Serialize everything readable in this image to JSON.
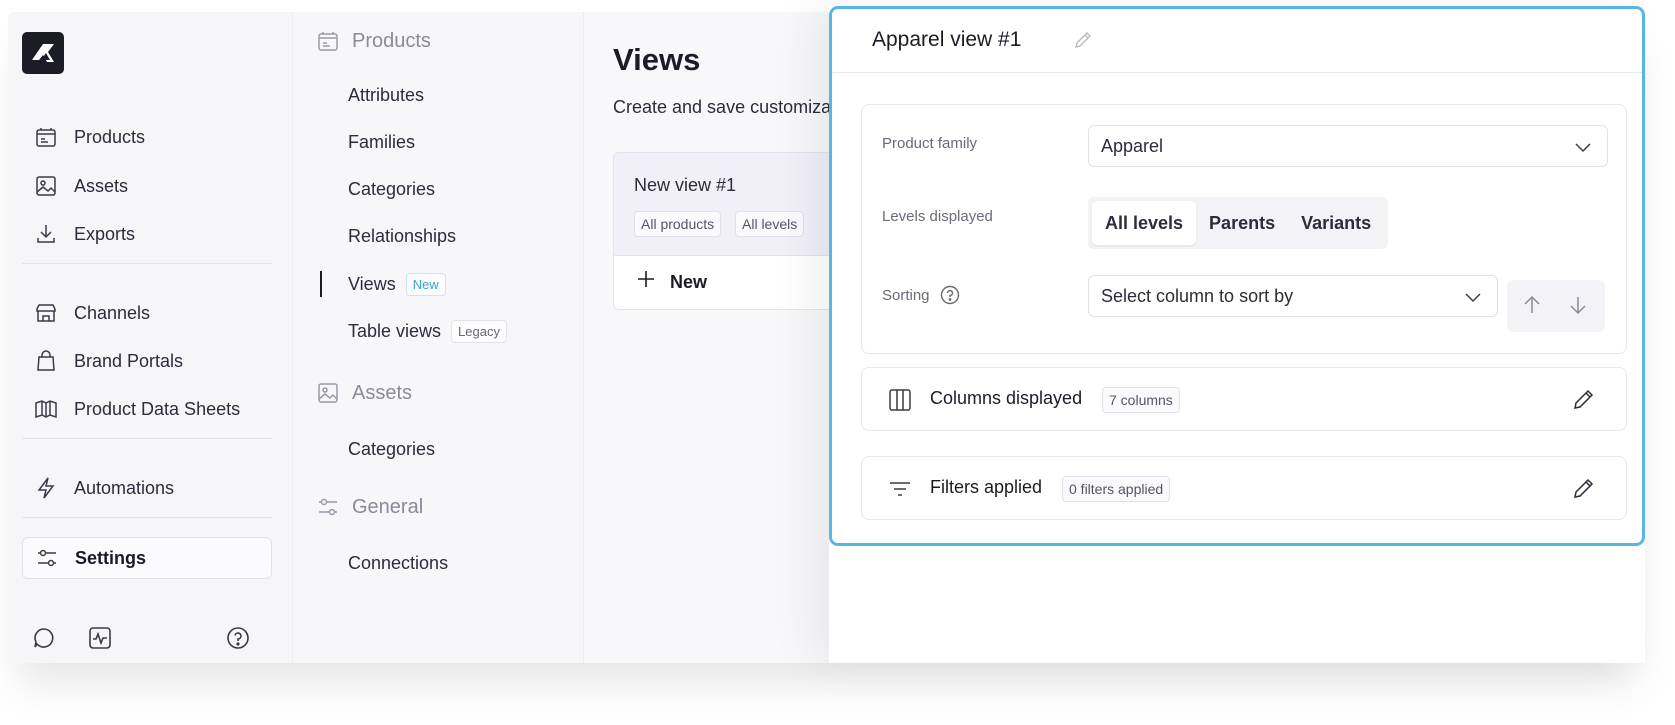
{
  "sidebar": {
    "items": [
      {
        "label": "Products",
        "icon": "products-icon"
      },
      {
        "label": "Assets",
        "icon": "image-icon"
      },
      {
        "label": "Exports",
        "icon": "download-icon"
      },
      {
        "label": "Channels",
        "icon": "storefront-icon"
      },
      {
        "label": "Brand Portals",
        "icon": "shopping-bag-icon"
      },
      {
        "label": "Product Data Sheets",
        "icon": "book-icon"
      },
      {
        "label": "Automations",
        "icon": "lightning-icon"
      },
      {
        "label": "Settings",
        "icon": "sliders-icon"
      }
    ],
    "footer_icons": [
      "chat-icon",
      "activity-icon",
      "help-icon"
    ]
  },
  "subnav": {
    "products_heading": "Products",
    "products_items": [
      "Attributes",
      "Families",
      "Categories",
      "Relationships"
    ],
    "views_label": "Views",
    "views_badge": "New",
    "table_views_label": "Table views",
    "table_views_badge": "Legacy",
    "assets_heading": "Assets",
    "assets_items": [
      "Categories"
    ],
    "general_heading": "General",
    "general_items": [
      "Connections"
    ]
  },
  "main": {
    "title": "Views",
    "subtitle": "Create and save customiza",
    "view_card": {
      "name": "New view #1",
      "chips": [
        "All products",
        "All levels"
      ]
    },
    "new_button": "New"
  },
  "panel": {
    "title": "Apparel view #1",
    "product_family_label": "Product family",
    "product_family_value": "Apparel",
    "levels_label": "Levels displayed",
    "levels_options": [
      "All levels",
      "Parents",
      "Variants"
    ],
    "levels_selected": "All levels",
    "sorting_label": "Sorting",
    "sorting_placeholder": "Select column to sort by",
    "columns_label": "Columns displayed",
    "columns_count": "7 columns",
    "filters_label": "Filters applied",
    "filters_count": "0 filters applied"
  },
  "colors": {
    "highlight": "#56b8e2",
    "new_badge": "#3aa0d8",
    "logo_bg": "#1c1c26"
  }
}
